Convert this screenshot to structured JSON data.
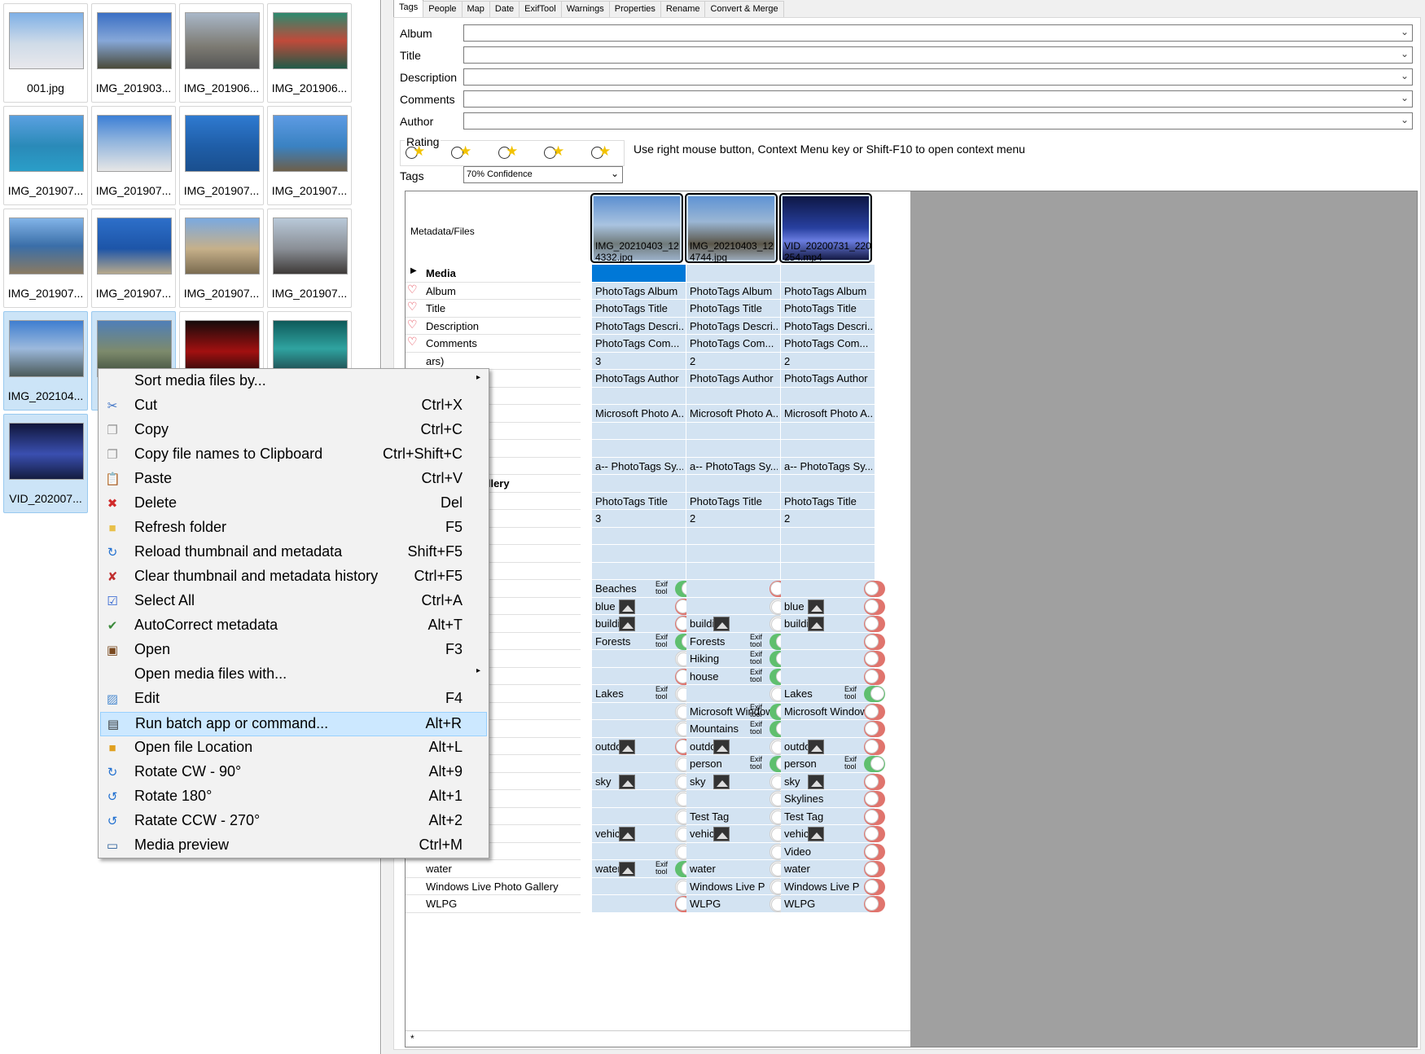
{
  "thumbnails": [
    {
      "caption": "001.jpg"
    },
    {
      "caption": "IMG_201903..."
    },
    {
      "caption": "IMG_201906..."
    },
    {
      "caption": "IMG_201906..."
    },
    {
      "caption": "IMG_201907..."
    },
    {
      "caption": "IMG_201907..."
    },
    {
      "caption": "IMG_201907..."
    },
    {
      "caption": "IMG_201907..."
    },
    {
      "caption": "IMG_201907..."
    },
    {
      "caption": "IMG_201907..."
    },
    {
      "caption": "IMG_201907..."
    },
    {
      "caption": "IMG_201907..."
    },
    {
      "caption": "IMG_202104..."
    },
    {
      "caption": ""
    },
    {
      "caption": ""
    },
    {
      "caption": ""
    },
    {
      "caption": "VID_202007..."
    }
  ],
  "tabs": [
    "Tags",
    "People",
    "Map",
    "Date",
    "ExifTool",
    "Warnings",
    "Properties",
    "Rename",
    "Convert & Merge"
  ],
  "fields": {
    "album": "Album",
    "title": "Title",
    "description": "Description",
    "comments": "Comments",
    "author": "Author"
  },
  "rating": {
    "legend": "Rating",
    "hint": "Use right mouse button, Context Menu key or Shift-F10 to open context menu"
  },
  "tags": {
    "label": "Tags",
    "value": "70% Confidence"
  },
  "grid": {
    "header_label": "Metadata/Files",
    "files": [
      "IMG_20210403_124332.jpg",
      "IMG_20210403_124744.jpg",
      "VID_20200731_220254.mp4"
    ],
    "rows": [
      {
        "label": "Media",
        "c": [
          "",
          "",
          ""
        ],
        "heading": true
      },
      {
        "label": "Album",
        "c": [
          "PhotoTags Album",
          "PhotoTags Album",
          "PhotoTags Album"
        ],
        "heart": true
      },
      {
        "label": "Title",
        "c": [
          "PhotoTags Title",
          "PhotoTags Title",
          "PhotoTags Title"
        ],
        "heart": true
      },
      {
        "label": "Description",
        "c": [
          "PhotoTags Descri...",
          "PhotoTags Descri...",
          "PhotoTags Descri..."
        ],
        "heart": true
      },
      {
        "label": "Comments",
        "c": [
          "PhotoTags Com...",
          "PhotoTags Com...",
          "PhotoTags Com..."
        ],
        "heart": true
      },
      {
        "label": "ars)",
        "c": [
          "3",
          "2",
          "2"
        ]
      },
      {
        "label": "",
        "c": [
          "PhotoTags Author",
          "PhotoTags Author",
          "PhotoTags Author"
        ]
      },
      {
        "label": "otos",
        "c": [
          "",
          "",
          ""
        ],
        "heading": true
      },
      {
        "label": "",
        "c": [
          "Microsoft Photo A...",
          "Microsoft Photo A...",
          "Microsoft Photo A..."
        ]
      },
      {
        "label": "",
        "c": [
          "",
          "",
          ""
        ]
      },
      {
        "label": "",
        "c": [
          "",
          "",
          ""
        ]
      },
      {
        "label": "",
        "c": [
          "a-- PhotoTags Sy...",
          "a-- PhotoTags Sy...",
          "a-- PhotoTags Sy..."
        ]
      },
      {
        "label": "ve Photo Gallery",
        "c": [
          "",
          "",
          ""
        ],
        "heading": true
      },
      {
        "label": "",
        "c": [
          "PhotoTags Title",
          "PhotoTags Title",
          "PhotoTags Title"
        ]
      },
      {
        "label": "ars)",
        "c": [
          "3",
          "2",
          "2"
        ]
      },
      {
        "label": "",
        "c": [
          "",
          "",
          ""
        ]
      },
      {
        "label": "",
        "c": [
          "",
          "",
          ""
        ]
      },
      {
        "label": "",
        "c": [
          "",
          "",
          ""
        ]
      },
      {
        "label": "",
        "c": [
          "Beaches",
          "",
          ""
        ],
        "t": [
          "g",
          "r",
          "r"
        ],
        "x": [
          1,
          0,
          0
        ]
      },
      {
        "label": "",
        "c": [
          "blue",
          "",
          "blue"
        ],
        "t": [
          "r",
          "w",
          "r"
        ],
        "m": [
          1,
          0,
          1
        ]
      },
      {
        "label": "",
        "c": [
          "buildi",
          "buildi",
          "buildi"
        ],
        "t": [
          "r",
          "w",
          "r"
        ],
        "m": [
          1,
          1,
          1
        ]
      },
      {
        "label": "",
        "c": [
          "Forests",
          "Forests",
          ""
        ],
        "t": [
          "g",
          "g",
          "r"
        ],
        "x": [
          1,
          1,
          0
        ]
      },
      {
        "label": "",
        "c": [
          "",
          "Hiking",
          ""
        ],
        "t": [
          "w",
          "g",
          "r"
        ],
        "x": [
          0,
          1,
          0
        ]
      },
      {
        "label": "",
        "c": [
          "",
          "house",
          ""
        ],
        "t": [
          "r",
          "g",
          "r"
        ],
        "x": [
          0,
          1,
          0
        ]
      },
      {
        "label": "",
        "c": [
          "Lakes",
          "",
          "Lakes"
        ],
        "t": [
          "w",
          "w",
          "g"
        ],
        "x": [
          1,
          0,
          1
        ]
      },
      {
        "label": "dows Photo",
        "c": [
          "",
          "Microsoft Windows",
          "Microsoft Windows"
        ],
        "t": [
          "w",
          "g",
          "r"
        ],
        "x": [
          0,
          1,
          0
        ]
      },
      {
        "label": "",
        "c": [
          "",
          "Mountains",
          ""
        ],
        "t": [
          "w",
          "g",
          "r"
        ],
        "x": [
          0,
          1,
          0
        ]
      },
      {
        "label": "",
        "c": [
          "outdoor",
          "outdoor",
          "outdoor"
        ],
        "t": [
          "r",
          "w",
          "r"
        ],
        "m": [
          1,
          1,
          1
        ]
      },
      {
        "label": "",
        "c": [
          "",
          "person",
          "person"
        ],
        "t": [
          "w",
          "g",
          "g"
        ],
        "x": [
          0,
          1,
          1
        ]
      },
      {
        "label": "sky",
        "c": [
          "sky",
          "sky",
          "sky"
        ],
        "t": [
          "w",
          "w",
          "r"
        ],
        "m": [
          1,
          1,
          1
        ]
      },
      {
        "label": "Skylines",
        "c": [
          "",
          "",
          "Skylines"
        ],
        "t": [
          "w",
          "w",
          "r"
        ]
      },
      {
        "label": "Test Tag",
        "c": [
          "",
          "Test Tag",
          "Test Tag"
        ],
        "t": [
          "w",
          "w",
          "r"
        ]
      },
      {
        "label": "vehicle",
        "c": [
          "vehicle",
          "vehicle",
          "vehicle"
        ],
        "t": [
          "w",
          "w",
          "r"
        ],
        "m": [
          1,
          1,
          1
        ]
      },
      {
        "label": "Video",
        "c": [
          "",
          "",
          "Video"
        ],
        "t": [
          "w",
          "w",
          "r"
        ]
      },
      {
        "label": "water",
        "c": [
          "water",
          "water",
          "water"
        ],
        "t": [
          "g",
          "w",
          "r"
        ],
        "m": [
          1,
          0,
          0
        ],
        "x": [
          1,
          0,
          0
        ]
      },
      {
        "label": "Windows Live Photo Gallery",
        "c": [
          "",
          "Windows Live P",
          "Windows Live P"
        ],
        "t": [
          "w",
          "w",
          "r"
        ]
      },
      {
        "label": "WLPG",
        "c": [
          "",
          "WLPG",
          "WLPG"
        ],
        "t": [
          "r",
          "w",
          "r"
        ]
      }
    ],
    "new_row_marker": "*",
    "exif_label": "Exif\ntool"
  },
  "context_menu": [
    {
      "label": "Sort media files by...",
      "shortcut": "",
      "icon": "",
      "submenu": true
    },
    {
      "label": "Cut",
      "shortcut": "Ctrl+X",
      "icon": "scissors-icon"
    },
    {
      "label": "Copy",
      "shortcut": "Ctrl+C",
      "icon": "copy-icon"
    },
    {
      "label": "Copy file names to Clipboard",
      "shortcut": "Ctrl+Shift+C",
      "icon": "copy-icon"
    },
    {
      "label": "Paste",
      "shortcut": "Ctrl+V",
      "icon": "paste-icon"
    },
    {
      "label": "Delete",
      "shortcut": "Del",
      "icon": "delete-icon"
    },
    {
      "label": "Refresh folder",
      "shortcut": "F5",
      "icon": "folder-icon"
    },
    {
      "label": "Reload thumbnail and metadata",
      "shortcut": "Shift+F5",
      "icon": "reload-icon"
    },
    {
      "label": "Clear thumbnail and metadata history",
      "shortcut": "Ctrl+F5",
      "icon": "clear-icon"
    },
    {
      "label": "Select All",
      "shortcut": "Ctrl+A",
      "icon": "select-all-icon"
    },
    {
      "label": "AutoCorrect metadata",
      "shortcut": "Alt+T",
      "icon": "autocorrect-icon"
    },
    {
      "label": "Open",
      "shortcut": "F3",
      "icon": "open-icon"
    },
    {
      "label": "Open media files with...",
      "shortcut": "",
      "icon": "",
      "submenu": true
    },
    {
      "label": "Edit",
      "shortcut": "F4",
      "icon": "edit-icon"
    },
    {
      "label": "Run batch app or command...",
      "shortcut": "Alt+R",
      "icon": "batch-icon",
      "highlight": true
    },
    {
      "label": "Open file Location",
      "shortcut": "Alt+L",
      "icon": "folder-location-icon"
    },
    {
      "label": "Rotate CW - 90°",
      "shortcut": "Alt+9",
      "icon": "rotate-cw-icon"
    },
    {
      "label": "Rotate 180°",
      "shortcut": "Alt+1",
      "icon": "rotate-180-icon"
    },
    {
      "label": "Ratate CCW - 270°",
      "shortcut": "Alt+2",
      "icon": "rotate-ccw-icon"
    },
    {
      "label": "Media preview",
      "shortcut": "Ctrl+M",
      "icon": "preview-icon"
    }
  ],
  "colors": {
    "accent": "#cce8ff",
    "selection": "#cce4f7",
    "cell": "#d3e3f2",
    "toggle_on": "#5fbf6e",
    "toggle_off": "#e0746d"
  }
}
